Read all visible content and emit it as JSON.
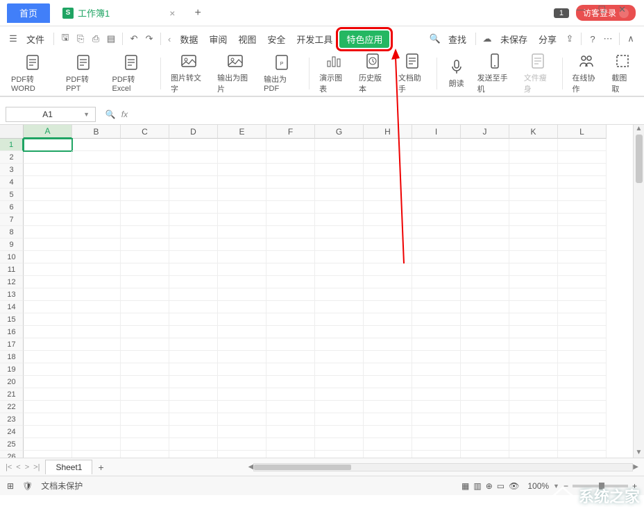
{
  "titlebar": {
    "home_tab": "首页",
    "doc_icon": "S",
    "doc_name": "工作簿1",
    "badge": "1",
    "login": "访客登录"
  },
  "menubar": {
    "file": "文件",
    "items": [
      "数据",
      "审阅",
      "视图",
      "安全",
      "开发工具"
    ],
    "special": "特色应用",
    "search": "查找",
    "unsaved": "未保存",
    "share": "分享"
  },
  "ribbon": {
    "buttons": [
      {
        "label": "PDF转WORD"
      },
      {
        "label": "PDF转PPT"
      },
      {
        "label": "PDF转Excel"
      },
      {
        "label": "图片转文字"
      },
      {
        "label": "输出为图片"
      },
      {
        "label": "输出为PDF"
      },
      {
        "label": "演示图表"
      },
      {
        "label": "历史版本"
      },
      {
        "label": "文档助手"
      },
      {
        "label": "朗读"
      },
      {
        "label": "发送至手机"
      },
      {
        "label": "文件瘦身",
        "disabled": true
      },
      {
        "label": "在线协作"
      },
      {
        "label": "截图取"
      }
    ]
  },
  "namebox": {
    "value": "A1",
    "fx": "fx"
  },
  "columns": [
    "A",
    "B",
    "C",
    "D",
    "E",
    "F",
    "G",
    "H",
    "I",
    "J",
    "K",
    "L"
  ],
  "rows_count": 26,
  "selected_cell": {
    "row": 1,
    "col": "A"
  },
  "sheets": {
    "active": "Sheet1"
  },
  "status": {
    "protect": "文档未保护",
    "zoom": "100%"
  },
  "watermark": "系统之家"
}
